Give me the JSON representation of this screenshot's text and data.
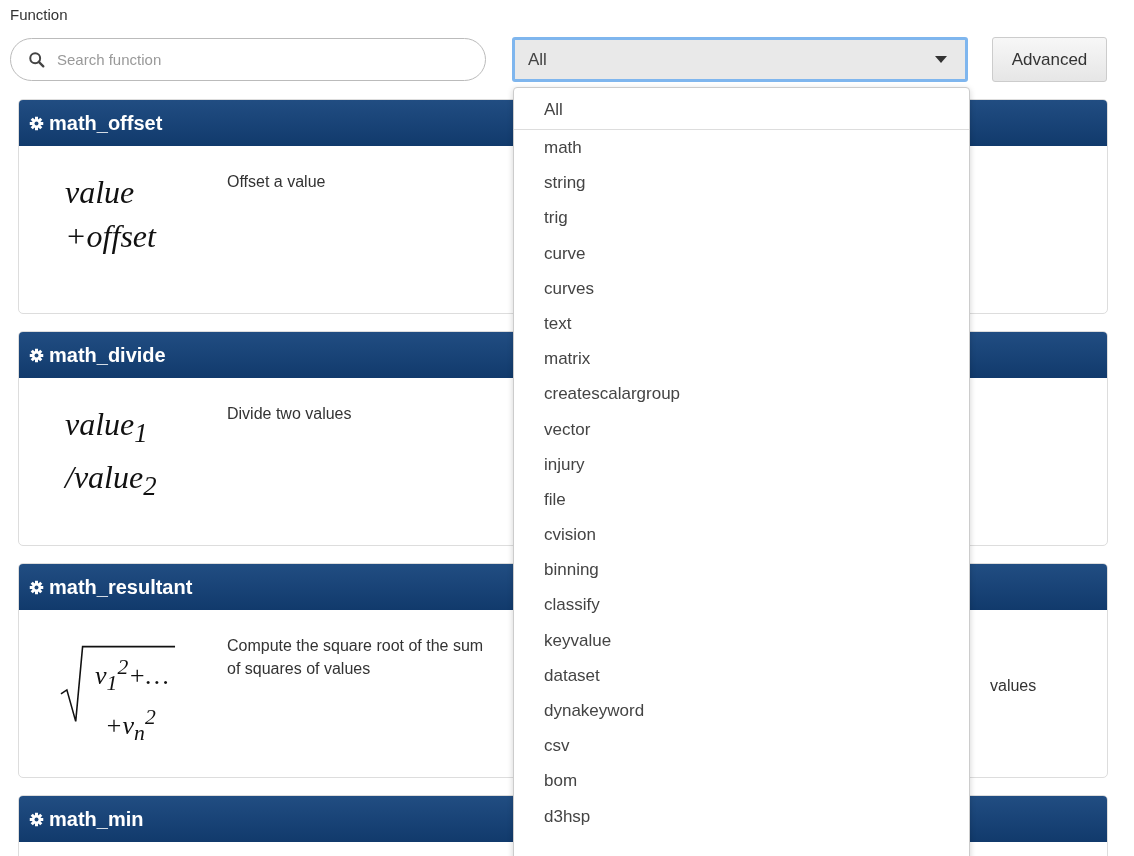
{
  "label": "Function",
  "search": {
    "placeholder": "Search function"
  },
  "category_select": {
    "value": "All",
    "expanded": true
  },
  "advanced_button": "Advanced",
  "dropdown_options": [
    {
      "label": "All",
      "selected": true
    },
    {
      "label": "math",
      "selected": false
    },
    {
      "label": "string",
      "selected": false
    },
    {
      "label": "trig",
      "selected": false
    },
    {
      "label": "curve",
      "selected": false
    },
    {
      "label": "curves",
      "selected": false
    },
    {
      "label": "text",
      "selected": false
    },
    {
      "label": "matrix",
      "selected": false
    },
    {
      "label": "createscalargroup",
      "selected": false
    },
    {
      "label": "vector",
      "selected": false
    },
    {
      "label": "injury",
      "selected": false
    },
    {
      "label": "file",
      "selected": false
    },
    {
      "label": "cvision",
      "selected": false
    },
    {
      "label": "binning",
      "selected": false
    },
    {
      "label": "classify",
      "selected": false
    },
    {
      "label": "keyvalue",
      "selected": false
    },
    {
      "label": "dataset",
      "selected": false
    },
    {
      "label": "dynakeyword",
      "selected": false
    },
    {
      "label": "csv",
      "selected": false
    },
    {
      "label": "bom",
      "selected": false
    },
    {
      "label": "d3hsp",
      "selected": false
    }
  ],
  "functions": [
    {
      "name": "math_offset",
      "formula": {
        "kind": "stack",
        "lines": [
          "value",
          "+offset"
        ]
      },
      "description": "Offset a value"
    },
    {
      "name": "math_divide",
      "formula": {
        "kind": "stack",
        "lines": [
          "value$_{1}$",
          "/value$_{2}$"
        ]
      },
      "description": "Divide two values"
    },
    {
      "name": "math_resultant",
      "formula": {
        "kind": "radical",
        "lines": [
          "v$_{1}$$^{2}$+…",
          "+v$_{n}$$^{2}$"
        ]
      },
      "description": "Compute the square root of the sum of squares of values",
      "column_3": "values"
    },
    {
      "name": "math_min"
    }
  ]
}
